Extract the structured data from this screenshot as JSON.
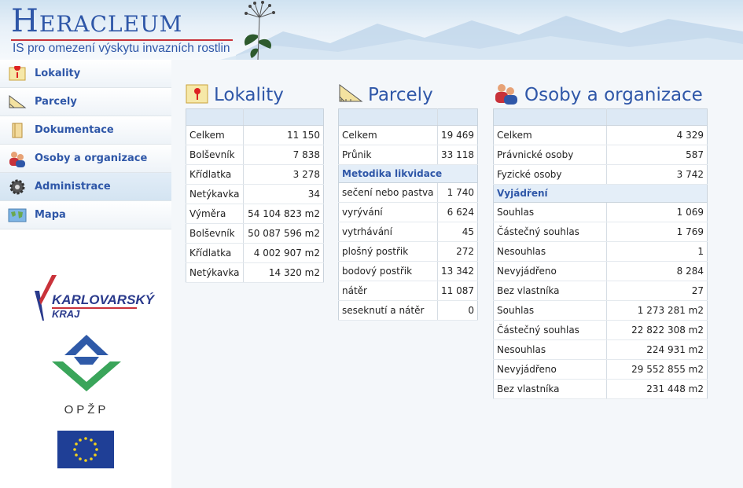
{
  "header": {
    "title": "Heracleum",
    "subtitle": "IS pro omezení výskytu invazních rostlin"
  },
  "sidebar": {
    "items": [
      {
        "label": "Lokality",
        "icon": "map-pin-icon"
      },
      {
        "label": "Parcely",
        "icon": "ruler-icon"
      },
      {
        "label": "Dokumentace",
        "icon": "document-icon"
      },
      {
        "label": "Osoby a organizace",
        "icon": "people-icon"
      },
      {
        "label": "Administrace",
        "icon": "gear-icon"
      },
      {
        "label": "Mapa",
        "icon": "world-map-icon"
      }
    ],
    "active_index": 4,
    "logos": {
      "kraj_line1": "KARLOVARSKÝ",
      "kraj_line2": "KRAJ",
      "opzp": "OPŽP"
    }
  },
  "panels": {
    "lokality": {
      "title": "Lokality",
      "rows": [
        {
          "label": "Celkem",
          "value": "11 150"
        },
        {
          "label": "Bolševník",
          "value": "7 838"
        },
        {
          "label": "Křídlatka",
          "value": "3 278"
        },
        {
          "label": "Netýkavka",
          "value": "34"
        },
        {
          "label": "Výměra",
          "value": "54 104 823 m2"
        },
        {
          "label": "Bolševník",
          "value": "50 087 596 m2"
        },
        {
          "label": "Křídlatka",
          "value": "4 002 907 m2"
        },
        {
          "label": "Netýkavka",
          "value": "14 320 m2"
        }
      ]
    },
    "parcely": {
      "title": "Parcely",
      "rows": [
        {
          "label": "Celkem",
          "value": "19 469"
        },
        {
          "label": "Průnik",
          "value": "33 118"
        }
      ],
      "section": "Metodika likvidace",
      "section_rows": [
        {
          "label": "sečení nebo pastva",
          "value": "1 740"
        },
        {
          "label": "vyrývání",
          "value": "6 624"
        },
        {
          "label": "vytrhávání",
          "value": "45"
        },
        {
          "label": "plošný postřik",
          "value": "272"
        },
        {
          "label": "bodový postřik",
          "value": "13 342"
        },
        {
          "label": "nátěr",
          "value": "11 087"
        },
        {
          "label": "seseknutí a nátěr",
          "value": "0"
        }
      ]
    },
    "osoby": {
      "title": "Osoby a organizace",
      "rows": [
        {
          "label": "Celkem",
          "value": "4 329"
        },
        {
          "label": "Právnické osoby",
          "value": "587"
        },
        {
          "label": "Fyzické osoby",
          "value": "3 742"
        }
      ],
      "section": "Vyjádření",
      "section_rows": [
        {
          "label": "Souhlas",
          "value": "1 069"
        },
        {
          "label": "Částečný souhlas",
          "value": "1 769"
        },
        {
          "label": "Nesouhlas",
          "value": "1"
        },
        {
          "label": "Nevyjádřeno",
          "value": "8 284"
        },
        {
          "label": "Bez vlastníka",
          "value": "27"
        },
        {
          "label": "Souhlas",
          "value": "1 273 281 m2"
        },
        {
          "label": "Částečný souhlas",
          "value": "22 822 308 m2"
        },
        {
          "label": "Nesouhlas",
          "value": "224 931 m2"
        },
        {
          "label": "Nevyjádřeno",
          "value": "29 552 855 m2"
        },
        {
          "label": "Bez vlastníka",
          "value": "231 448 m2"
        }
      ]
    }
  },
  "colors": {
    "brand_blue": "#2f57a8",
    "accent_red": "#c9323a",
    "header_row": "#dde9f5"
  }
}
